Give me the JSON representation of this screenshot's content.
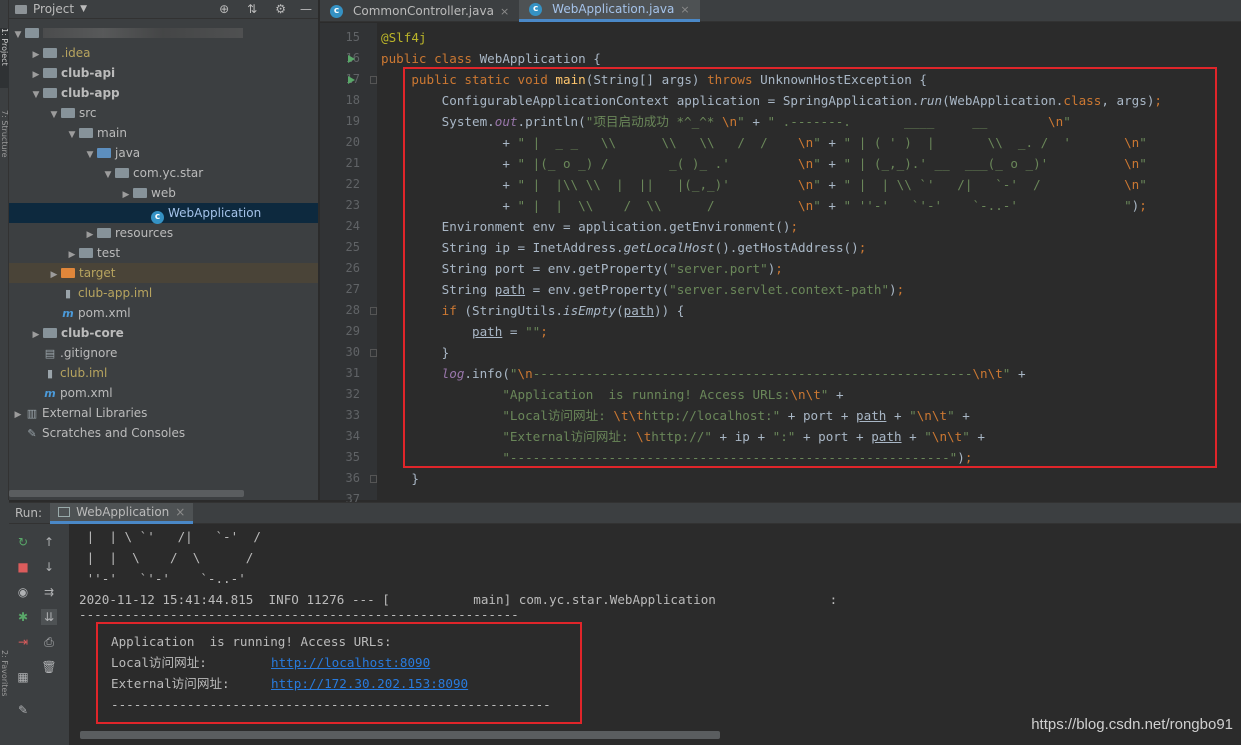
{
  "side_strip": {
    "top_label": "1: Project",
    "mid_label": "7: Structure",
    "bottom_label": "2: Favorites"
  },
  "project_panel": {
    "title": "Project",
    "items": [
      {
        "label": "",
        "level": 0,
        "arrow": "▼",
        "icon": "folder",
        "note": "blurred-root"
      },
      {
        "label": ".idea",
        "level": 1,
        "arrow": "▶",
        "icon": "folder",
        "color": "#b7a45f"
      },
      {
        "label": "club-api",
        "level": 1,
        "arrow": "▶",
        "icon": "folder",
        "bold": true
      },
      {
        "label": "club-app",
        "level": 1,
        "arrow": "▼",
        "icon": "folder",
        "bold": true
      },
      {
        "label": "src",
        "level": 2,
        "arrow": "▼",
        "icon": "folder"
      },
      {
        "label": "main",
        "level": 3,
        "arrow": "▼",
        "icon": "folder"
      },
      {
        "label": "java",
        "level": 4,
        "arrow": "▼",
        "icon": "folder-blue"
      },
      {
        "label": "com.yc.star",
        "level": 5,
        "arrow": "▼",
        "icon": "folder"
      },
      {
        "label": "web",
        "level": 6,
        "arrow": "▶",
        "icon": "folder"
      },
      {
        "label": "WebApplication",
        "level": 7,
        "arrow": "",
        "icon": "class",
        "color": "#a5c3ea"
      },
      {
        "label": "resources",
        "level": 4,
        "arrow": "▶",
        "icon": "folder"
      },
      {
        "label": "test",
        "level": 3,
        "arrow": "▶",
        "icon": "folder"
      },
      {
        "label": "target",
        "level": 2,
        "arrow": "▶",
        "icon": "folder-orange",
        "color": "#b7a45f"
      },
      {
        "label": "club-app.iml",
        "level": 2,
        "arrow": "",
        "icon": "iml",
        "color": "#b7a45f"
      },
      {
        "label": "pom.xml",
        "level": 2,
        "arrow": "",
        "icon": "maven"
      },
      {
        "label": "club-core",
        "level": 1,
        "arrow": "▶",
        "icon": "folder",
        "bold": true
      },
      {
        "label": ".gitignore",
        "level": 1,
        "arrow": "",
        "icon": "file"
      },
      {
        "label": "club.iml",
        "level": 1,
        "arrow": "",
        "icon": "iml",
        "color": "#b7a45f"
      },
      {
        "label": "pom.xml",
        "level": 1,
        "arrow": "",
        "icon": "maven"
      },
      {
        "label": "External Libraries",
        "level": 0,
        "arrow": "▶",
        "icon": "library"
      },
      {
        "label": "Scratches and Consoles",
        "level": 0,
        "arrow": "",
        "icon": "scratch"
      }
    ]
  },
  "editor": {
    "tabs": [
      {
        "label": "CommonController.java",
        "active": false
      },
      {
        "label": "WebApplication.java",
        "active": true
      }
    ],
    "line_numbers": [
      "15",
      "16",
      "17",
      "18",
      "19",
      "20",
      "21",
      "22",
      "23",
      "24",
      "25",
      "26",
      "27",
      "28",
      "29",
      "30",
      "31",
      "32",
      "33",
      "34",
      "35",
      "36",
      "37"
    ]
  },
  "run_panel": {
    "run_label": "Run:",
    "tab_label": "WebApplication",
    "console_lines": [
      " |  | \\ `'   /|   `-'  /",
      " |  |  \\    /  \\      /",
      " ''-'   `'-'    `-..-'",
      "",
      "2020-11-12 15:41:44.815  INFO 11276 --- [           main] com.yc.star.WebApplication               :",
      "----------------------------------------------------------"
    ],
    "access": {
      "header": "Application  is running! Access URLs:",
      "local_label": "Local访问网址:",
      "local_url": "http://localhost:8090",
      "external_label": "External访问网址:",
      "external_url": "http://172.30.202.153:8090",
      "divider": "----------------------------------------------------------"
    }
  },
  "watermark": "https://blog.csdn.net/rongbo91"
}
